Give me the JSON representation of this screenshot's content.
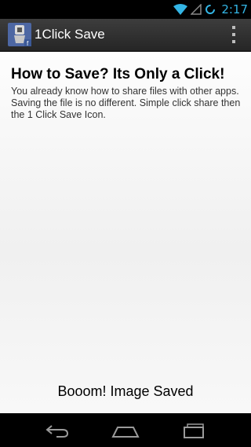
{
  "status_bar": {
    "time": "2:17",
    "icons": [
      "wifi-icon",
      "signal-icon",
      "sync-icon"
    ]
  },
  "action_bar": {
    "app_icon": "app-icon",
    "title": "1Click Save",
    "overflow_icon": "overflow-menu-icon"
  },
  "main": {
    "heading": "How to Save? Its Only a Click!",
    "body": "You already know how to share files with other apps. Saving the file is no different.  Simple click share then the 1 Click Save Icon.",
    "saved_message": "Booom! Image Saved"
  },
  "nav_bar": {
    "icons": [
      "back-icon",
      "home-icon",
      "recents-icon"
    ]
  },
  "colors": {
    "accent": "#33b5e5",
    "action_bar": "#333333",
    "content_bg": "#f4f4f4"
  }
}
